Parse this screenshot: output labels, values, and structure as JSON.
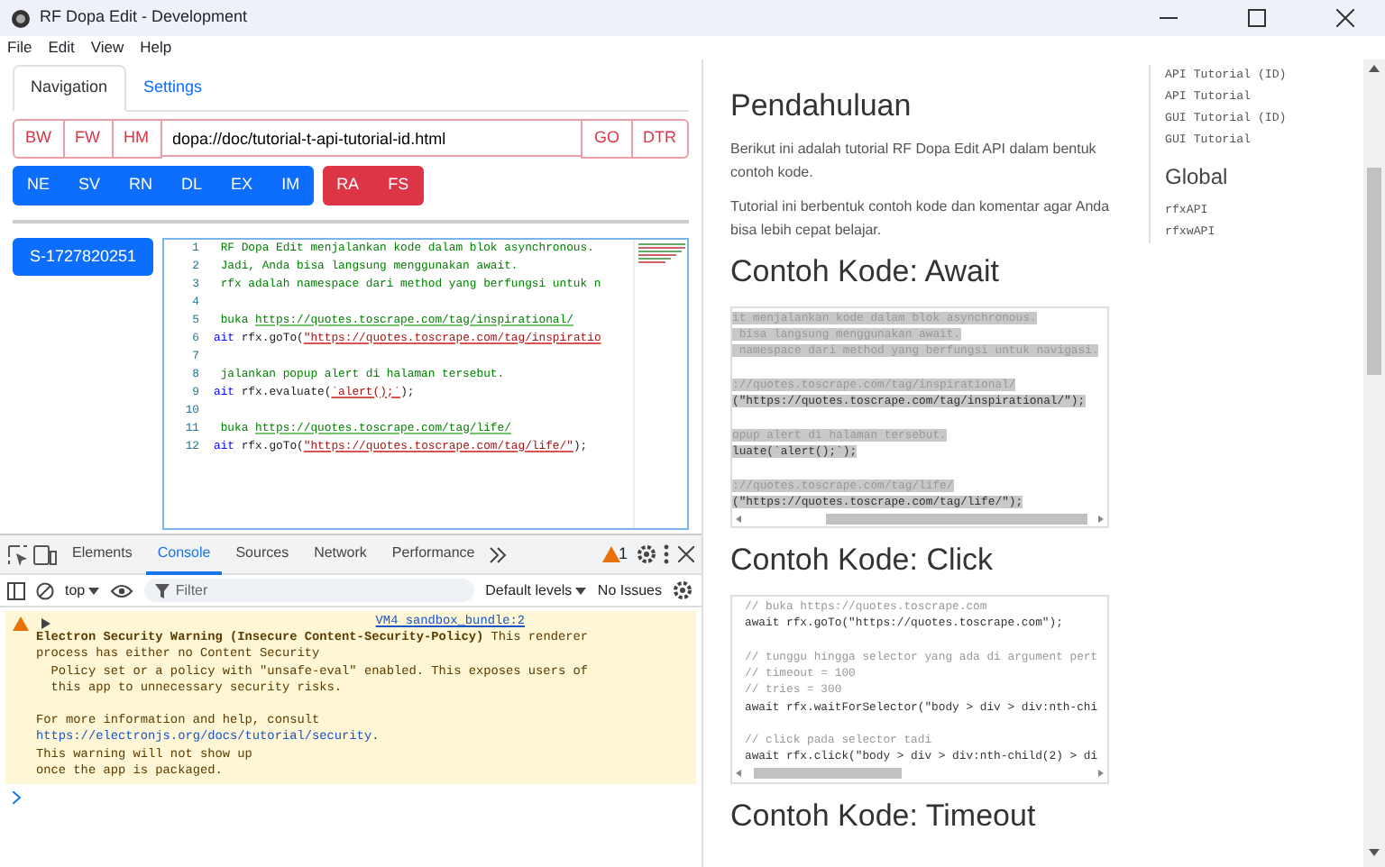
{
  "window": {
    "title": "RF Dopa Edit - Development"
  },
  "menu": [
    "File",
    "Edit",
    "View",
    "Help"
  ],
  "tabs": [
    {
      "label": "Navigation",
      "selected": true
    },
    {
      "label": "Settings",
      "selected": false
    }
  ],
  "nav_bar": {
    "left_buttons": [
      "BW",
      "FW",
      "HM"
    ],
    "url": "dopa://doc/tutorial-t-api-tutorial-id.html",
    "right_buttons": [
      "GO",
      "DTR"
    ]
  },
  "action_groups": [
    {
      "kind": "primary",
      "buttons": [
        "NE",
        "SV",
        "RN",
        "DL",
        "EX",
        "IM"
      ]
    },
    {
      "kind": "danger",
      "buttons": [
        "RA",
        "FS"
      ]
    }
  ],
  "scripts": [
    {
      "label": "S-1727820251",
      "selected": true
    }
  ],
  "editor": {
    "lines": [
      {
        "number": "1",
        "segments": [
          {
            "kind": "comment",
            "text": " RF Dopa Edit menjalankan kode dalam blok asynchronous."
          }
        ]
      },
      {
        "number": "2",
        "segments": [
          {
            "kind": "comment",
            "text": " Jadi, Anda bisa langsung menggunakan await."
          }
        ]
      },
      {
        "number": "3",
        "segments": [
          {
            "kind": "comment",
            "text": " rfx adalah namespace dari method yang berfungsi untuk n"
          }
        ]
      },
      {
        "number": "4"
      },
      {
        "number": "5",
        "segments": [
          {
            "kind": "comment",
            "text": " buka "
          },
          {
            "kind": "link",
            "text": "https://quotes.toscrape.com/tag/inspirational/"
          }
        ]
      },
      {
        "number": "6",
        "segments": [
          {
            "kind": "keyword",
            "text": "ait"
          },
          {
            "kind": "code",
            "text": " rfx.goTo("
          },
          {
            "kind": "string",
            "text": "\"https://quotes.toscrape.com/tag/inspiratio"
          }
        ]
      },
      {
        "number": "7"
      },
      {
        "number": "8",
        "segments": [
          {
            "kind": "comment",
            "text": " jalankan popup alert di halaman tersebut."
          }
        ]
      },
      {
        "number": "9",
        "segments": [
          {
            "kind": "keyword",
            "text": "ait"
          },
          {
            "kind": "code",
            "text": " rfx.evaluate("
          },
          {
            "kind": "string",
            "text": "`alert();`"
          },
          {
            "kind": "code",
            "text": ");"
          }
        ]
      },
      {
        "number": "10"
      },
      {
        "number": "11",
        "segments": [
          {
            "kind": "comment",
            "text": " buka "
          },
          {
            "kind": "link",
            "text": "https://quotes.toscrape.com/tag/life/"
          }
        ]
      },
      {
        "number": "12",
        "segments": [
          {
            "kind": "keyword",
            "text": "ait"
          },
          {
            "kind": "code",
            "text": " rfx.goTo("
          },
          {
            "kind": "string",
            "text": "\"https://quotes.toscrape.com/tag/life/\""
          },
          {
            "kind": "code",
            "text": ");"
          }
        ]
      }
    ]
  },
  "devtools": {
    "tabs": [
      {
        "label": "Elements",
        "selected": false
      },
      {
        "label": "Console",
        "selected": true
      },
      {
        "label": "Sources",
        "selected": false
      },
      {
        "label": "Network",
        "selected": false
      },
      {
        "label": "Performance",
        "selected": false
      }
    ],
    "warning_count": "1",
    "context": "top",
    "filter_placeholder": "Filter",
    "levels": "Default levels",
    "issues": "No Issues",
    "message": {
      "source": "VM4 sandbox_bundle:2",
      "lines": [
        "**Electron Security Warning (Insecure Content-Security-Policy)** This renderer",
        "process has either no Content Security",
        "  Policy set or a policy with \"unsafe-eval\" enabled. This exposes users of",
        "  this app to unnecessary security risks."
      ],
      "help_line": "For more information and help, consult",
      "link": "https://electronjs.org/docs/tutorial/security",
      "link_suffix": ".",
      "after_lines": [
        "This warning will not show up",
        "once the app is packaged."
      ]
    }
  },
  "document": {
    "sections": [
      {
        "heading": "Pendahuluan",
        "paragraphs": [
          "Berikut ini adalah tutorial RF Dopa Edit API dalam bentuk contoh kode.",
          "Tutorial ini berbentuk contoh kode dan komentar agar Anda bisa lebih cepat belajar."
        ]
      },
      {
        "heading": "Contoh Kode: Await",
        "code": {
          "highlighted": true,
          "lines": [
            {
              "kind": "comment",
              "text": "it menjalankan kode dalam blok asynchronous."
            },
            {
              "kind": "comment",
              "text": " bisa langsung menggunakan await."
            },
            {
              "kind": "comment",
              "text": " namespace dari method yang berfungsi untuk navigasi."
            },
            {
              "kind": "blank"
            },
            {
              "kind": "comment",
              "text": "://quotes.toscrape.com/tag/inspirational/"
            },
            {
              "kind": "code",
              "text": "(\"https://quotes.toscrape.com/tag/inspirational/\");"
            },
            {
              "kind": "blank"
            },
            {
              "kind": "comment",
              "text": "opup alert di halaman tersebut."
            },
            {
              "kind": "code",
              "text": "luate(`alert();`);"
            },
            {
              "kind": "blank"
            },
            {
              "kind": "comment",
              "text": "://quotes.toscrape.com/tag/life/"
            },
            {
              "kind": "code",
              "text": "(\"https://quotes.toscrape.com/tag/life/\");"
            }
          ]
        }
      },
      {
        "heading": "Contoh Kode: Click",
        "code": {
          "highlighted": false,
          "lines": [
            {
              "kind": "comment",
              "text": "// buka https://quotes.toscrape.com"
            },
            {
              "kind": "code",
              "text": "await rfx.goTo(\"https://quotes.toscrape.com\");"
            },
            {
              "kind": "blank"
            },
            {
              "kind": "comment",
              "text": "// tunggu hingga selector yang ada di argument pert"
            },
            {
              "kind": "comment",
              "text": "// timeout = 100"
            },
            {
              "kind": "comment",
              "text": "// tries = 300"
            },
            {
              "kind": "code",
              "text": "await rfx.waitForSelector(\"body > div > div:nth-chi"
            },
            {
              "kind": "blank"
            },
            {
              "kind": "comment",
              "text": "// click pada selector tadi"
            },
            {
              "kind": "code",
              "text": "await rfx.click(\"body > div > div:nth-child(2) > di"
            }
          ]
        }
      },
      {
        "heading": "Contoh Kode: Timeout"
      }
    ]
  },
  "toc": {
    "links": [
      "API Tutorial (ID)",
      "API Tutorial",
      "GUI Tutorial (ID)",
      "GUI Tutorial"
    ],
    "heading": "Global",
    "global_links": [
      "rfxAPI",
      "rfxwAPI"
    ]
  }
}
